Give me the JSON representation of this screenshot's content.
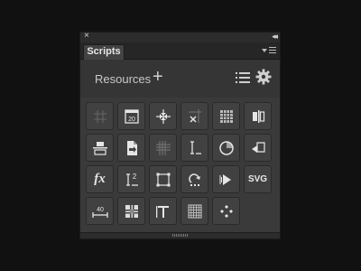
{
  "panel": {
    "title": "Scripts",
    "resources_label": "Resources",
    "add_glyph": "+",
    "close_glyph": "×",
    "collapse_glyph": "◂◂"
  },
  "tools": [
    {
      "name": "crosshair-grid-icon"
    },
    {
      "name": "calendar-icon",
      "text": "20"
    },
    {
      "name": "center-crosshair-icon"
    },
    {
      "name": "delete-guides-icon"
    },
    {
      "name": "table-grid-icon"
    },
    {
      "name": "align-edge-icon"
    },
    {
      "name": "align-center-horizontal-icon"
    },
    {
      "name": "document-export-icon"
    },
    {
      "name": "hatch-grid-icon"
    },
    {
      "name": "text-cursor-icon"
    },
    {
      "name": "circle-icon"
    },
    {
      "name": "shape-arrow-icon"
    },
    {
      "name": "fx-icon",
      "text": "fx"
    },
    {
      "name": "superscript-cursor-icon",
      "text": "2"
    },
    {
      "name": "selection-box-icon"
    },
    {
      "name": "rotate-arrow-icon"
    },
    {
      "name": "play-step-icon"
    },
    {
      "name": "svg-icon",
      "text": "SVG"
    },
    {
      "name": "measure-icon",
      "text": "40"
    },
    {
      "name": "pattern-grid-icon"
    },
    {
      "name": "text-tool-icon"
    },
    {
      "name": "dense-grid-icon"
    },
    {
      "name": "diamond-dots-icon"
    }
  ]
}
